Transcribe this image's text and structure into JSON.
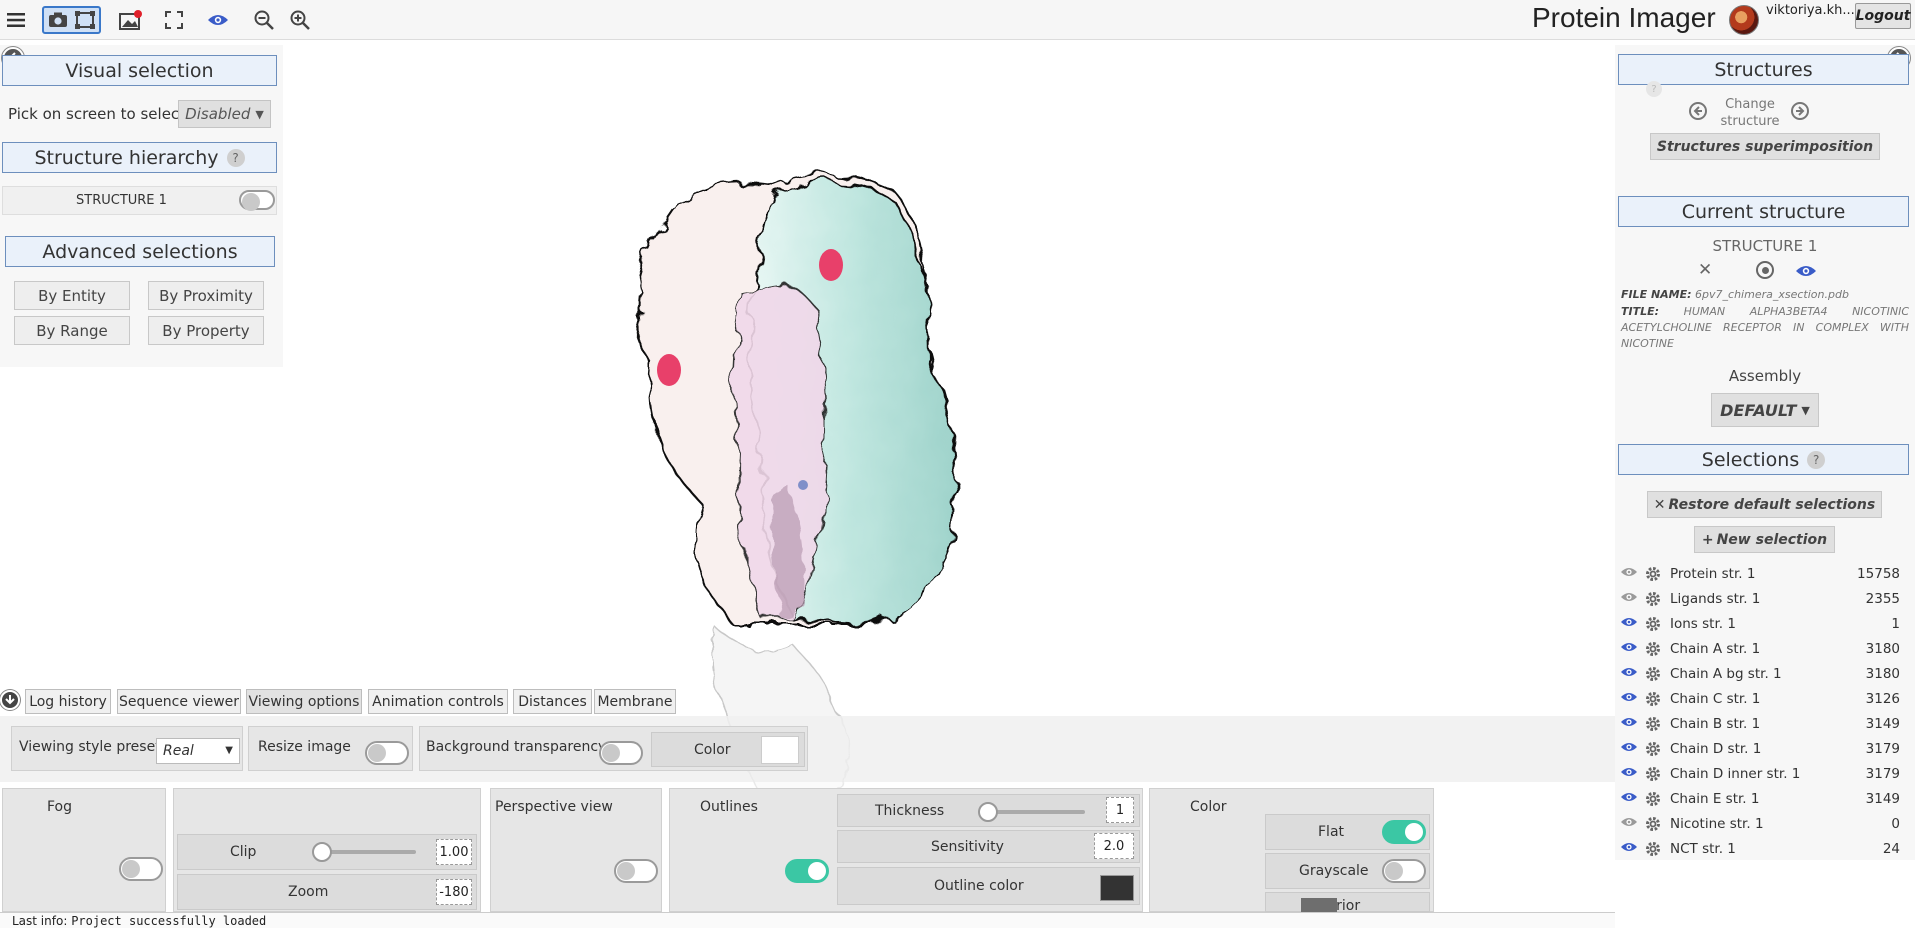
{
  "app": {
    "title": "Protein Imager",
    "username": "viktoriya.kh...",
    "logout_label": "Logout"
  },
  "visual_selection": {
    "title": "Visual selection",
    "pick_label": "Pick on screen to select",
    "pick_value": "Disabled"
  },
  "hierarchy": {
    "title": "Structure hierarchy",
    "help": "?",
    "structure_name": "STRUCTURE 1"
  },
  "advanced": {
    "title": "Advanced selections",
    "buttons": [
      "By Entity",
      "By Proximity",
      "By Range",
      "By Property"
    ]
  },
  "structures": {
    "title": "Structures",
    "change_label": "Change structure",
    "superimposition_label": "Structures superimposition"
  },
  "current_structure": {
    "title": "Current structure",
    "name": "STRUCTURE 1",
    "file_name_label": "FILE NAME:",
    "file_name": "6pv7_chimera_xsection.pdb",
    "title_label": "TITLE:",
    "title_text": "HUMAN ALPHA3BETA4 NICOTINIC ACETYLCHOLINE RECEPTOR IN COMPLEX WITH NICOTINE",
    "assembly_label": "Assembly",
    "assembly_value": "DEFAULT"
  },
  "selections": {
    "title": "Selections",
    "help": "?",
    "restore_label": "Restore default selections",
    "new_label": "New selection",
    "rows": [
      {
        "label": "Protein str. 1",
        "count": "15758",
        "visible": false
      },
      {
        "label": "Ligands str. 1",
        "count": "2355",
        "visible": false
      },
      {
        "label": "Ions str. 1",
        "count": "1",
        "visible": true
      },
      {
        "label": "Chain A str. 1",
        "count": "3180",
        "visible": true
      },
      {
        "label": "Chain A bg str. 1",
        "count": "3180",
        "visible": true
      },
      {
        "label": "Chain C str. 1",
        "count": "3126",
        "visible": true
      },
      {
        "label": "Chain B str. 1",
        "count": "3149",
        "visible": true
      },
      {
        "label": "Chain D str. 1",
        "count": "3179",
        "visible": true
      },
      {
        "label": "Chain D inner str. 1",
        "count": "3179",
        "visible": true
      },
      {
        "label": "Chain E str. 1",
        "count": "3149",
        "visible": true
      },
      {
        "label": "Nicotine str. 1",
        "count": "0",
        "visible": false
      },
      {
        "label": "NCT str. 1",
        "count": "24",
        "visible": true
      }
    ]
  },
  "dock": {
    "tabs": [
      "Log history",
      "Sequence viewer",
      "Viewing options",
      "Animation controls",
      "Distances",
      "Membrane"
    ],
    "active_tab": "Viewing options"
  },
  "viewing_options": {
    "preset_label": "Viewing style preset",
    "preset_value": "Real",
    "resize_label": "Resize image",
    "bg_transparency_label": "Background transparency",
    "color_label": "Color",
    "fog_label": "Fog",
    "clip_label": "Clip",
    "clip_value": "1.00",
    "zoom_label": "Zoom",
    "zoom_value": "-180",
    "perspective_label": "Perspective view",
    "outlines_label": "Outlines",
    "thickness_label": "Thickness",
    "thickness_value": "1",
    "sensitivity_label": "Sensitivity",
    "sensitivity_value": "2.0",
    "outline_color_label": "Outline color",
    "color_section_label": "Color",
    "flat_label": "Flat",
    "grayscale_label": "Grayscale",
    "interior_label": "Interior",
    "colors": {
      "outline": "#333333",
      "interior": "#6e6e6e",
      "toggle_on": "#3bc7a4",
      "accent": "#6d8fbd"
    }
  },
  "status": {
    "label": "Last info:",
    "message": "Project successfully loaded"
  }
}
